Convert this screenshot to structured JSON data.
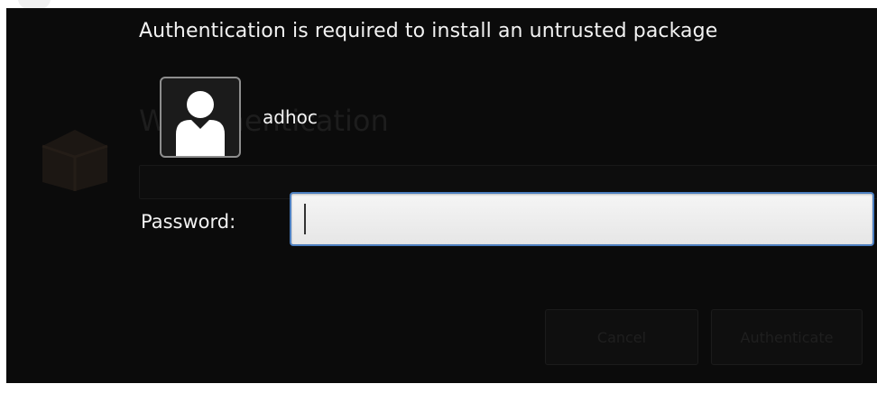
{
  "dialog": {
    "message": "Authentication is required to install an untrusted package",
    "user": {
      "name": "adhoc",
      "avatar_icon": "user-avatar-icon"
    },
    "password": {
      "label": "Password:",
      "value": "",
      "placeholder": ""
    }
  },
  "background_window": {
    "icon": "package-icon",
    "title": "W     Authentication",
    "buttons": {
      "cancel_label": "Cancel",
      "authenticate_label": "Authenticate"
    }
  },
  "colors": {
    "dialog_bg": "#0b0b0b",
    "text": "#f2f2f2",
    "focus_border": "#4d7fc0",
    "avatar_border": "#8e8e8e"
  }
}
